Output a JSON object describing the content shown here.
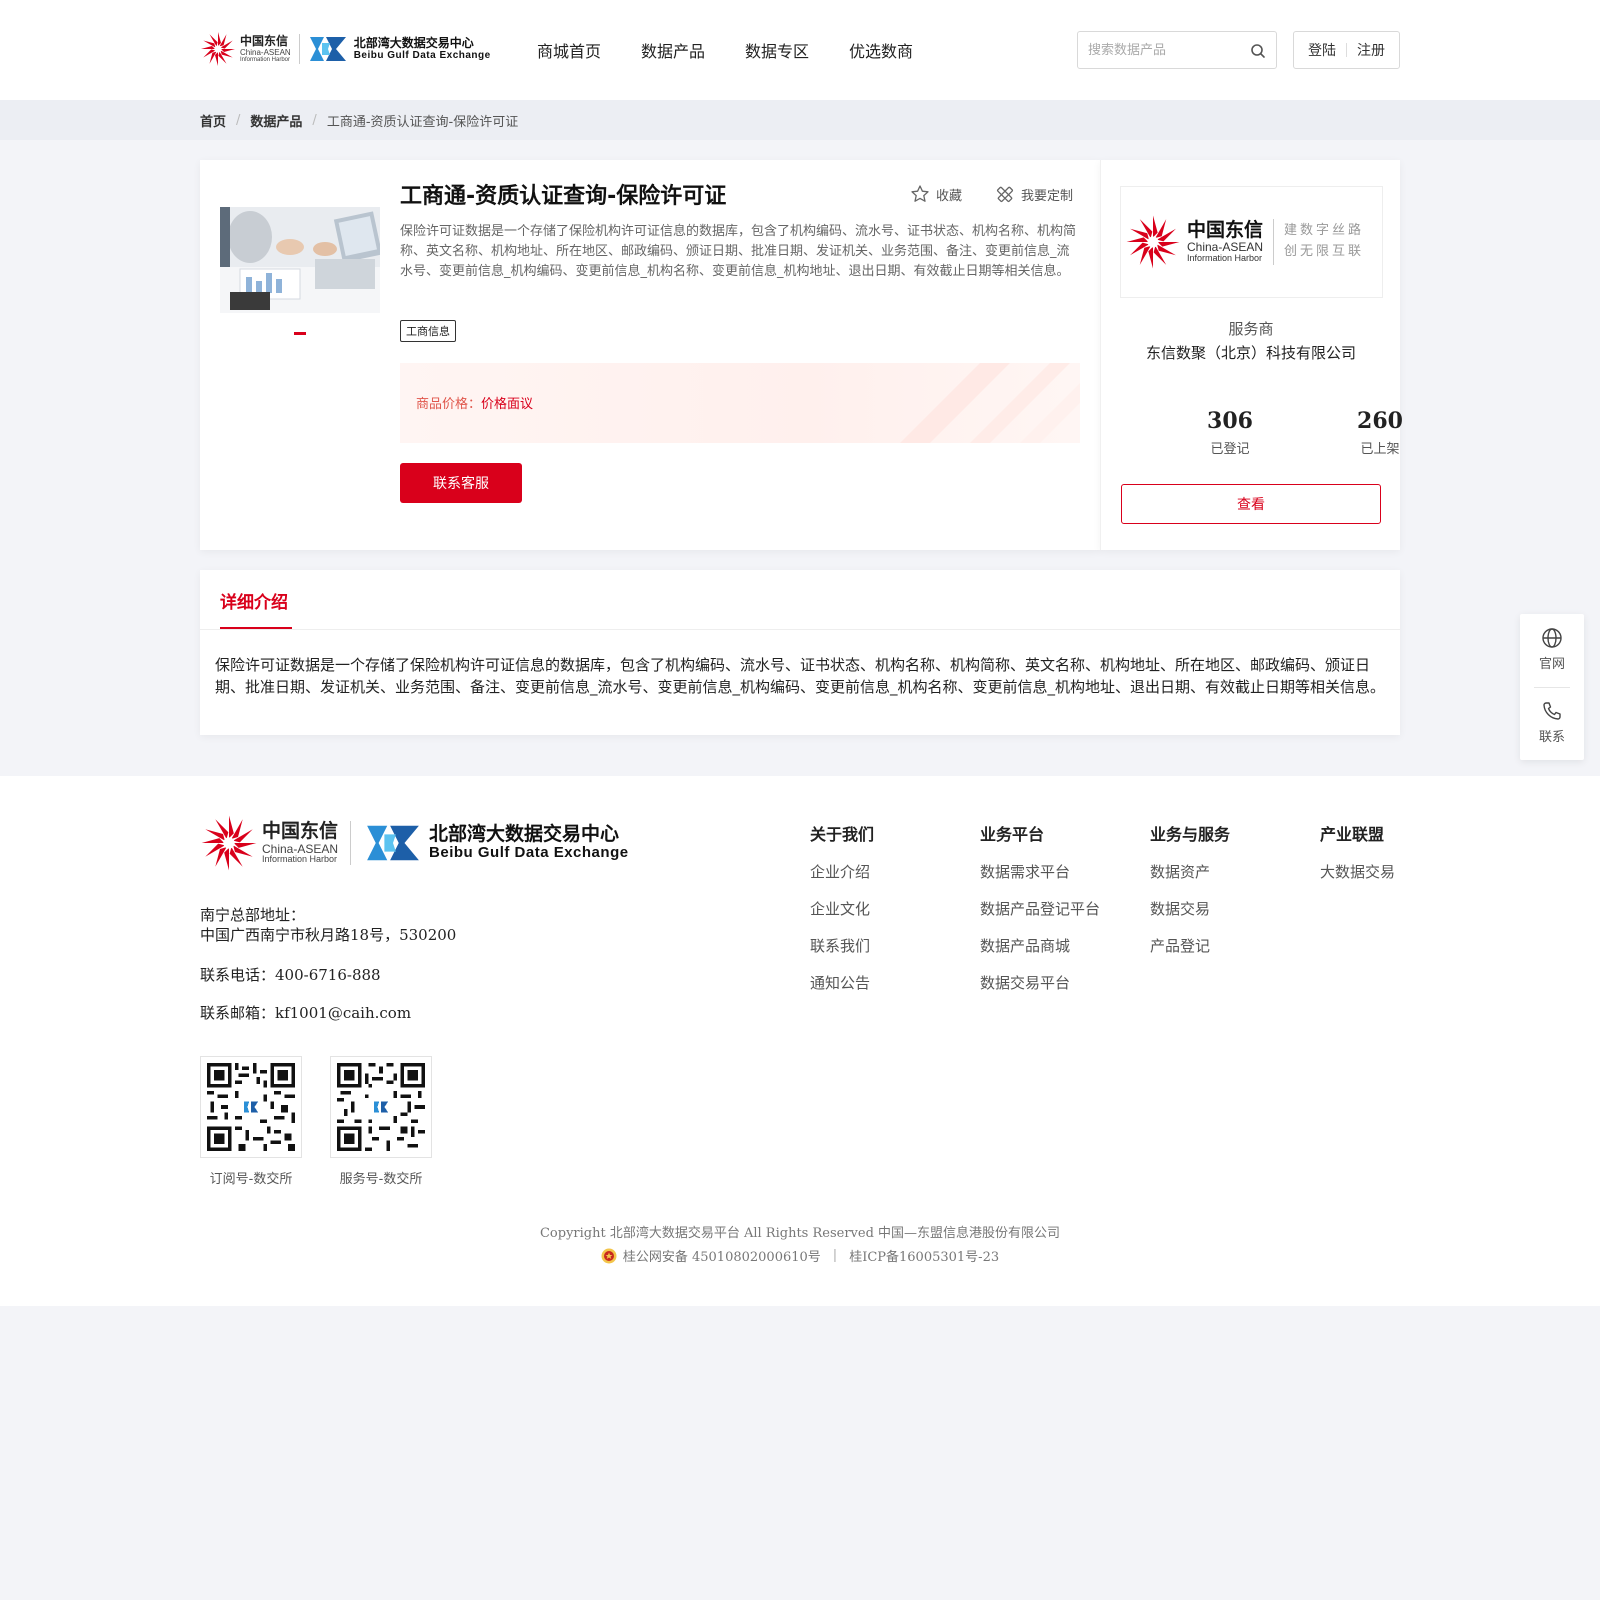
{
  "header": {
    "logo_cn_zh": "中国东信",
    "logo_cn_en1": "China-ASEAN",
    "logo_cn_en2": "Information Harbor",
    "logo_bx_zh": "北部湾大数据交易中心",
    "logo_bx_en": "Beibu Gulf Data Exchange",
    "nav": [
      "商城首页",
      "数据产品",
      "数据专区",
      "优选数商"
    ],
    "search_placeholder": "搜索数据产品",
    "login": "登陆",
    "register": "注册"
  },
  "breadcrumb": {
    "home": "首页",
    "category": "数据产品",
    "current": "工商通-资质认证查询-保险许可证"
  },
  "product": {
    "title": "工商通-资质认证查询-保险许可证",
    "favorite": "收藏",
    "customize": "我要定制",
    "description": "保险许可证数据是一个存储了保险机构许可证信息的数据库，包含了机构编码、流水号、证书状态、机构名称、机构简称、英文名称、机构地址、所在地区、邮政编码、颁证日期、批准日期、发证机关、业务范围、备注、变更前信息_流水号、变更前信息_机构编码、变更前信息_机构名称、变更前信息_机构地址、退出日期、有效截止日期等相关信息。",
    "tag": "工商信息",
    "price_label": "商品价格：",
    "price_value": "价格面议",
    "contact_button": "联系客服"
  },
  "vendor": {
    "logo_zh": "中国东信",
    "logo_en1": "China-ASEAN",
    "logo_en2": "Information Harbor",
    "slogan_1": "建数字丝路",
    "slogan_2": "创无限互联",
    "role": "服务商",
    "name": "东信数聚（北京）科技有限公司",
    "registered_count": "306",
    "registered_label": "已登记",
    "listed_count": "260",
    "listed_label": "已上架",
    "view_button": "查看"
  },
  "detail": {
    "tab": "详细介绍",
    "body": "保险许可证数据是一个存储了保险机构许可证信息的数据库，包含了机构编码、流水号、证书状态、机构名称、机构简称、英文名称、机构地址、所在地区、邮政编码、颁证日期、批准日期、发证机关、业务范围、备注、变更前信息_流水号、变更前信息_机构编码、变更前信息_机构名称、变更前信息_机构地址、退出日期、有效截止日期等相关信息。"
  },
  "float_sidebar": {
    "website": "官网",
    "contact": "联系"
  },
  "footer": {
    "address_label": "南宁总部地址：",
    "address": "中国广西南宁市秋月路18号，530200",
    "phone": "联系电话：400-6716-888",
    "email": "联系邮箱：kf1001@caih.com",
    "qr_1_caption": "订阅号-数交所",
    "qr_2_caption": "服务号-数交所",
    "columns": [
      {
        "title": "关于我们",
        "links": [
          "企业介绍",
          "企业文化",
          "联系我们",
          "通知公告"
        ]
      },
      {
        "title": "业务平台",
        "links": [
          "数据需求平台",
          "数据产品登记平台",
          "数据产品商城",
          "数据交易平台"
        ]
      },
      {
        "title": "业务与服务",
        "links": [
          "数据资产",
          "数据交易",
          "产品登记"
        ]
      },
      {
        "title": "产业联盟",
        "links": [
          "大数据交易"
        ]
      }
    ],
    "copyright": "Copyright 北部湾大数据交易平台 All Rights Reserved 中国—东盟信息港股份有限公司",
    "police_record": "桂公网安备 45010802000610号",
    "icp": "桂ICP备16005301号-23"
  },
  "colors": {
    "brand_red": "#d9001b",
    "page_bg": "#f3f4f8"
  }
}
